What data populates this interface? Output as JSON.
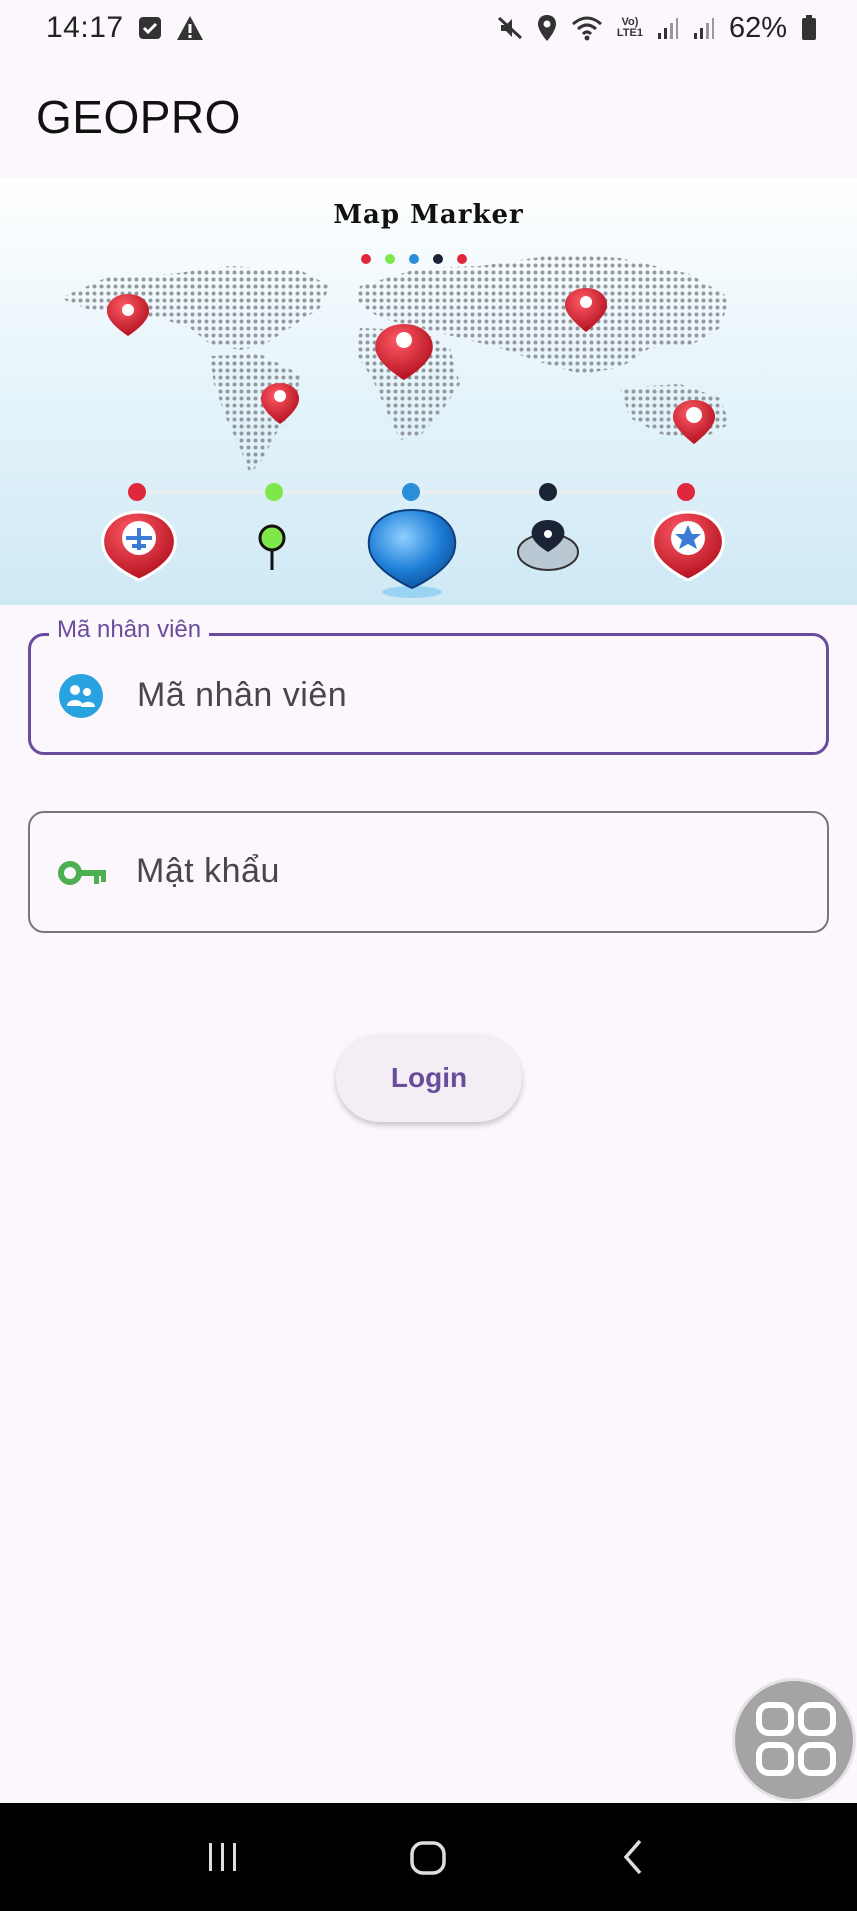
{
  "status_bar": {
    "time": "14:17",
    "battery_percent": "62%",
    "left_icons": [
      "checkbox-notification-icon",
      "warning-icon"
    ],
    "right_icons": [
      "mute-icon",
      "location-icon",
      "wifi-icon",
      "volte-icon",
      "signal-icon",
      "signal-icon",
      "battery-icon"
    ],
    "network_label_top": "Vo)",
    "network_label_bottom": "LTE1"
  },
  "app_bar": {
    "title": "GEOPRO"
  },
  "banner": {
    "title": "Map Marker",
    "dot_colors": [
      "#e0283c",
      "#7ee84a",
      "#2a8fd6",
      "#1b2436",
      "#e0283c"
    ]
  },
  "form": {
    "employee_id": {
      "label": "Mã nhân viên",
      "placeholder": "Mã nhân viên",
      "icon": "people-icon",
      "focused": true
    },
    "password": {
      "placeholder": "Mật khẩu",
      "icon": "key-icon"
    },
    "login_label": "Login"
  },
  "colors": {
    "primary": "#6a4c9c",
    "background": "#fcf7fc",
    "people_icon": "#29a3e0",
    "key_icon": "#4caf50"
  },
  "nav_bar": {
    "buttons": [
      "recent-apps-icon",
      "home-icon",
      "back-icon"
    ]
  }
}
